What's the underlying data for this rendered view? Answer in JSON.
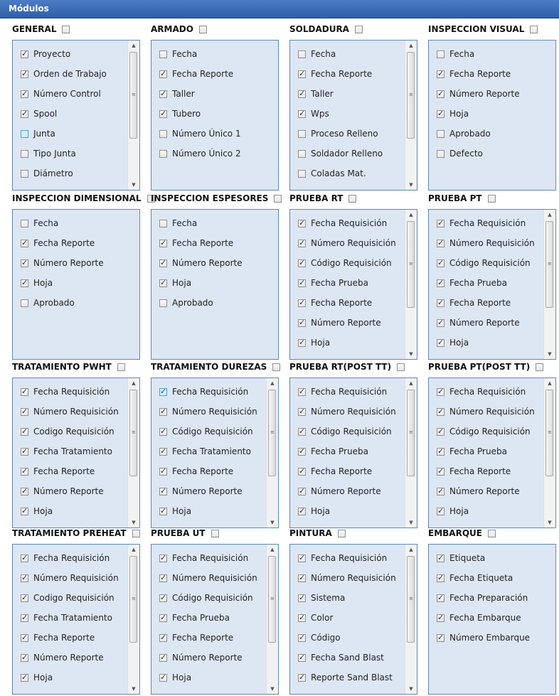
{
  "header": {
    "title": "Módulos"
  },
  "modules": [
    {
      "title": "GENERAL",
      "checked": false,
      "scroll": true,
      "items": [
        {
          "label": "Proyecto",
          "checked": true
        },
        {
          "label": "Orden de Trabajo",
          "checked": true
        },
        {
          "label": "Número Control",
          "checked": true
        },
        {
          "label": "Spool",
          "checked": true
        },
        {
          "label": "Junta",
          "checked": false,
          "highlight": true
        },
        {
          "label": "Tipo Junta",
          "checked": false
        },
        {
          "label": "Diámetro",
          "checked": false
        }
      ]
    },
    {
      "title": "ARMADO",
      "checked": false,
      "scroll": false,
      "items": [
        {
          "label": "Fecha",
          "checked": false
        },
        {
          "label": "Fecha Reporte",
          "checked": true
        },
        {
          "label": "Taller",
          "checked": true
        },
        {
          "label": "Tubero",
          "checked": true
        },
        {
          "label": "Número Único 1",
          "checked": false
        },
        {
          "label": "Número Único 2",
          "checked": false
        }
      ]
    },
    {
      "title": "SOLDADURA",
      "checked": false,
      "scroll": true,
      "items": [
        {
          "label": "Fecha",
          "checked": false
        },
        {
          "label": "Fecha Reporte",
          "checked": true
        },
        {
          "label": "Taller",
          "checked": true
        },
        {
          "label": "Wps",
          "checked": true
        },
        {
          "label": "Proceso Relleno",
          "checked": false
        },
        {
          "label": "Soldador Relleno",
          "checked": false
        },
        {
          "label": "Coladas Mat.",
          "checked": false
        }
      ]
    },
    {
      "title": "INSPECCION VISUAL",
      "checked": false,
      "scroll": false,
      "items": [
        {
          "label": "Fecha",
          "checked": false
        },
        {
          "label": "Fecha Reporte",
          "checked": true
        },
        {
          "label": "Número Reporte",
          "checked": true
        },
        {
          "label": "Hoja",
          "checked": true
        },
        {
          "label": "Aprobado",
          "checked": false
        },
        {
          "label": "Defecto",
          "checked": false
        }
      ]
    },
    {
      "title": "INSPECCION DIMENSIONAL",
      "checked": false,
      "scroll": false,
      "items": [
        {
          "label": "Fecha",
          "checked": false
        },
        {
          "label": "Fecha Reporte",
          "checked": true
        },
        {
          "label": "Número Reporte",
          "checked": true
        },
        {
          "label": "Hoja",
          "checked": true
        },
        {
          "label": "Aprobado",
          "checked": false
        }
      ]
    },
    {
      "title": "INSPECCION ESPESORES",
      "checked": false,
      "scroll": false,
      "items": [
        {
          "label": "Fecha",
          "checked": false
        },
        {
          "label": "Fecha Reporte",
          "checked": true
        },
        {
          "label": "Número Reporte",
          "checked": true
        },
        {
          "label": "Hoja",
          "checked": true
        },
        {
          "label": "Aprobado",
          "checked": false
        }
      ]
    },
    {
      "title": "PRUEBA RT",
      "checked": false,
      "scroll": true,
      "items": [
        {
          "label": "Fecha Requisición",
          "checked": true
        },
        {
          "label": "Número Requisición",
          "checked": true
        },
        {
          "label": "Código Requisición",
          "checked": true
        },
        {
          "label": "Fecha Prueba",
          "checked": true
        },
        {
          "label": "Fecha Reporte",
          "checked": true
        },
        {
          "label": "Número Reporte",
          "checked": true
        },
        {
          "label": "Hoja",
          "checked": true
        }
      ]
    },
    {
      "title": "PRUEBA PT",
      "checked": false,
      "scroll": true,
      "items": [
        {
          "label": "Fecha Requisición",
          "checked": true
        },
        {
          "label": "Número Requisición",
          "checked": true
        },
        {
          "label": "Código Requisición",
          "checked": true
        },
        {
          "label": "Fecha Prueba",
          "checked": true
        },
        {
          "label": "Fecha Reporte",
          "checked": true
        },
        {
          "label": "Número Reporte",
          "checked": true
        },
        {
          "label": "Hoja",
          "checked": true
        }
      ]
    },
    {
      "title": "TRATAMIENTO PWHT",
      "checked": false,
      "scroll": true,
      "items": [
        {
          "label": "Fecha Requisición",
          "checked": true
        },
        {
          "label": "Número Requisición",
          "checked": true
        },
        {
          "label": "Codigo Requisición",
          "checked": true
        },
        {
          "label": "Fecha Tratamiento",
          "checked": true
        },
        {
          "label": "Fecha Reporte",
          "checked": true
        },
        {
          "label": "Número Reporte",
          "checked": true
        },
        {
          "label": "Hoja",
          "checked": true
        }
      ]
    },
    {
      "title": "TRATAMIENTO DUREZAS",
      "checked": false,
      "scroll": true,
      "items": [
        {
          "label": "Fecha Requisición",
          "checked": true,
          "highlight": true
        },
        {
          "label": "Número Requisición",
          "checked": true
        },
        {
          "label": "Código Requisición",
          "checked": true
        },
        {
          "label": "Fecha Tratamiento",
          "checked": true
        },
        {
          "label": "Fecha Reporte",
          "checked": true
        },
        {
          "label": "Número Reporte",
          "checked": true
        },
        {
          "label": "Hoja",
          "checked": true
        }
      ]
    },
    {
      "title": "PRUEBA RT(POST TT)",
      "checked": false,
      "scroll": true,
      "items": [
        {
          "label": "Fecha Requisición",
          "checked": true
        },
        {
          "label": "Número Requisición",
          "checked": true
        },
        {
          "label": "Código Requisición",
          "checked": true
        },
        {
          "label": "Fecha Prueba",
          "checked": true
        },
        {
          "label": "Fecha Reporte",
          "checked": true
        },
        {
          "label": "Número Reporte",
          "checked": true
        },
        {
          "label": "Hoja",
          "checked": true
        }
      ]
    },
    {
      "title": "PRUEBA PT(POST TT)",
      "checked": false,
      "scroll": true,
      "items": [
        {
          "label": "Fecha Requisición",
          "checked": true
        },
        {
          "label": "Número Requisición",
          "checked": true
        },
        {
          "label": "Código Requisición",
          "checked": true
        },
        {
          "label": "Fecha Prueba",
          "checked": true
        },
        {
          "label": "Fecha Reporte",
          "checked": true
        },
        {
          "label": "Número Reporte",
          "checked": true
        },
        {
          "label": "Hoja",
          "checked": true
        }
      ]
    },
    {
      "title": "TRATAMIENTO PREHEAT",
      "checked": false,
      "scroll": true,
      "items": [
        {
          "label": "Fecha Requisición",
          "checked": true
        },
        {
          "label": "Número Requisición",
          "checked": true
        },
        {
          "label": "Codigo Requisición",
          "checked": true
        },
        {
          "label": "Fecha Tratamiento",
          "checked": true
        },
        {
          "label": "Fecha Reporte",
          "checked": true
        },
        {
          "label": "Número Reporte",
          "checked": true
        },
        {
          "label": "Hoja",
          "checked": true
        }
      ]
    },
    {
      "title": "PRUEBA UT",
      "checked": false,
      "scroll": true,
      "items": [
        {
          "label": "Fecha Requisición",
          "checked": true
        },
        {
          "label": "Número Requisición",
          "checked": true
        },
        {
          "label": "Código Requisición",
          "checked": true
        },
        {
          "label": "Fecha Prueba",
          "checked": true
        },
        {
          "label": "Fecha Reporte",
          "checked": true
        },
        {
          "label": "Número Reporte",
          "checked": true
        },
        {
          "label": "Hoja",
          "checked": true
        }
      ]
    },
    {
      "title": "PINTURA",
      "checked": false,
      "scroll": true,
      "items": [
        {
          "label": "Fecha Requisición",
          "checked": true
        },
        {
          "label": "Número Requisición",
          "checked": true
        },
        {
          "label": "Sistema",
          "checked": true
        },
        {
          "label": "Color",
          "checked": true
        },
        {
          "label": "Código",
          "checked": true
        },
        {
          "label": "Fecha Sand Blast",
          "checked": true
        },
        {
          "label": "Reporte Sand Blast",
          "checked": true
        }
      ]
    },
    {
      "title": "EMBARQUE",
      "checked": false,
      "scroll": false,
      "items": [
        {
          "label": "Etiqueta",
          "checked": true
        },
        {
          "label": "Fecha Etiqueta",
          "checked": true
        },
        {
          "label": "Fecha Preparación",
          "checked": true
        },
        {
          "label": "Fecha Embarque",
          "checked": true
        },
        {
          "label": "Número Embarque",
          "checked": true
        }
      ]
    }
  ]
}
